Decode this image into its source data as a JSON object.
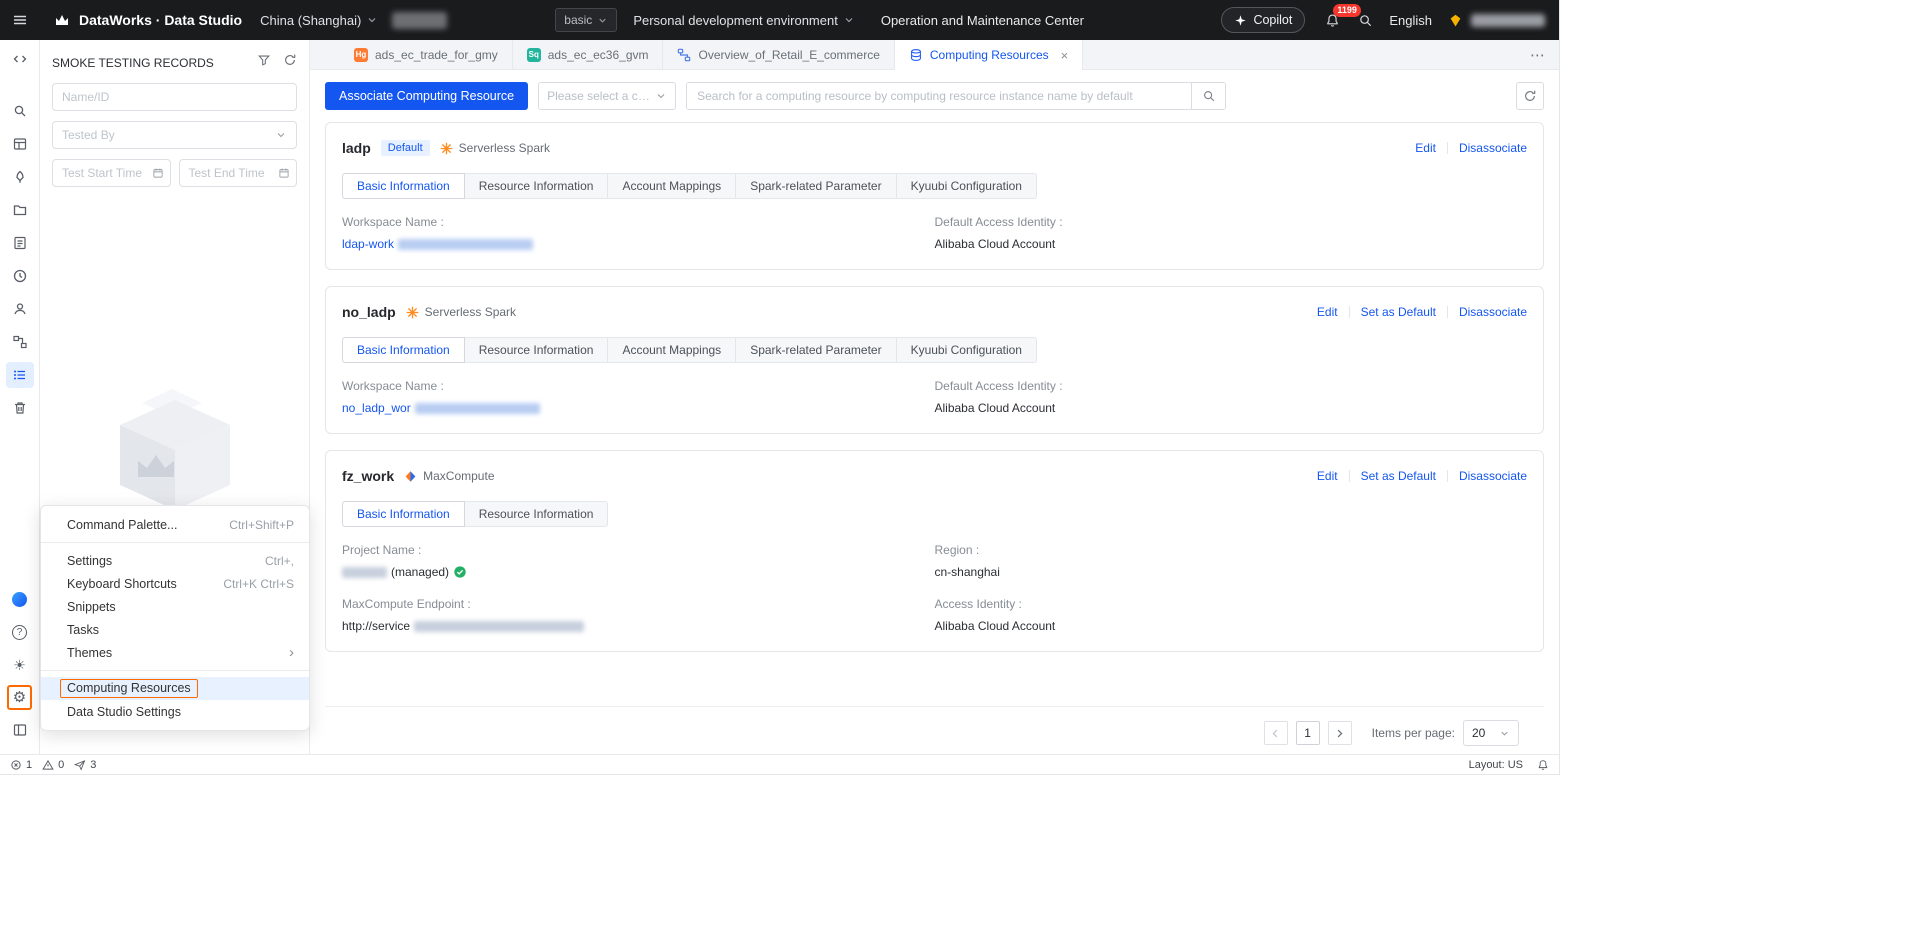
{
  "colors": {
    "accent_blue": "#1456f0",
    "highlight_orange": "#ff6a00",
    "notification_red": "#f5372e",
    "topbar_bg": "#1a1b1d",
    "spark_orange": "#ff8a1e",
    "hologres_badge": "#ff7a33",
    "sql_badge": "#23b59c",
    "success_green": "#23b066"
  },
  "glyphs": {
    "close": "×",
    "more": "⋯",
    "question": "?",
    "gear": "⚙",
    "sun": "☀",
    "chevron_right": "›"
  },
  "topbar": {
    "brand": "DataWorks · Data Studio",
    "region": "China (Shanghai)",
    "mode_select": "basic",
    "environment": "Personal development environment",
    "module": "Operation and Maintenance Center",
    "copilot": "Copilot",
    "notification_count": "1199",
    "language": "English"
  },
  "panel": {
    "title": "SMOKE TESTING RECORDS",
    "name_input_placeholder": "Name/ID",
    "tested_by_placeholder": "Tested By",
    "test_start_placeholder": "Test Start Time",
    "test_end_placeholder": "Test End Time"
  },
  "context_menu": {
    "command_palette": {
      "label": "Command Palette...",
      "shortcut": "Ctrl+Shift+P"
    },
    "settings": {
      "label": "Settings",
      "shortcut": "Ctrl+,"
    },
    "keyboard_shortcuts": {
      "label": "Keyboard Shortcuts",
      "shortcut": "Ctrl+K Ctrl+S"
    },
    "snippets": {
      "label": "Snippets"
    },
    "tasks": {
      "label": "Tasks"
    },
    "themes": {
      "label": "Themes"
    },
    "computing_resources": {
      "label": "Computing Resources"
    },
    "data_studio_settings": {
      "label": "Data Studio Settings"
    }
  },
  "editor_tabs": [
    {
      "label": "ads_ec_trade_for_gmy",
      "badge": "Hg"
    },
    {
      "label": "ads_ec_ec36_gvm",
      "badge": "Sq"
    },
    {
      "label": "Overview_of_Retail_E_commerce"
    },
    {
      "label": "Computing Resources"
    }
  ],
  "toolbar": {
    "associate_button": "Associate Computing Resource",
    "type_select_placeholder": "Please select a comput",
    "search_placeholder": "Search for a computing resource by computing resource instance name by default"
  },
  "cards": [
    {
      "name": "ladp",
      "badge": "Default",
      "engine": "Serverless Spark",
      "actions": [
        "Edit",
        "Disassociate"
      ],
      "tabs": [
        "Basic Information",
        "Resource Information",
        "Account Mappings",
        "Spark-related Parameter",
        "Kyuubi Configuration"
      ],
      "workspace_label": "Workspace Name :",
      "workspace_value": "ldap-work",
      "identity_label": "Default Access Identity :",
      "identity_value": "Alibaba Cloud Account"
    },
    {
      "name": "no_ladp",
      "engine": "Serverless Spark",
      "actions": [
        "Edit",
        "Set as Default",
        "Disassociate"
      ],
      "tabs": [
        "Basic Information",
        "Resource Information",
        "Account Mappings",
        "Spark-related Parameter",
        "Kyuubi Configuration"
      ],
      "workspace_label": "Workspace Name :",
      "workspace_value": "no_ladp_wor",
      "identity_label": "Default Access Identity :",
      "identity_value": "Alibaba Cloud Account"
    },
    {
      "name": "fz_work",
      "engine": "MaxCompute",
      "actions": [
        "Edit",
        "Set as Default",
        "Disassociate"
      ],
      "tabs": [
        "Basic Information",
        "Resource Information"
      ],
      "project_label": "Project Name :",
      "project_value_suffix": "(managed)",
      "region_label": "Region :",
      "region_value": "cn-shanghai",
      "endpoint_label": "MaxCompute Endpoint :",
      "endpoint_value": "http://service",
      "access_label": "Access Identity :",
      "access_value": "Alibaba Cloud Account"
    }
  ],
  "pagination": {
    "page": "1",
    "items_per_page_label": "Items per page:",
    "items_per_page_value": "20"
  },
  "statusbar": {
    "error_count": "1",
    "warning_count": "0",
    "deploy_count": "3",
    "layout": "Layout: US"
  }
}
